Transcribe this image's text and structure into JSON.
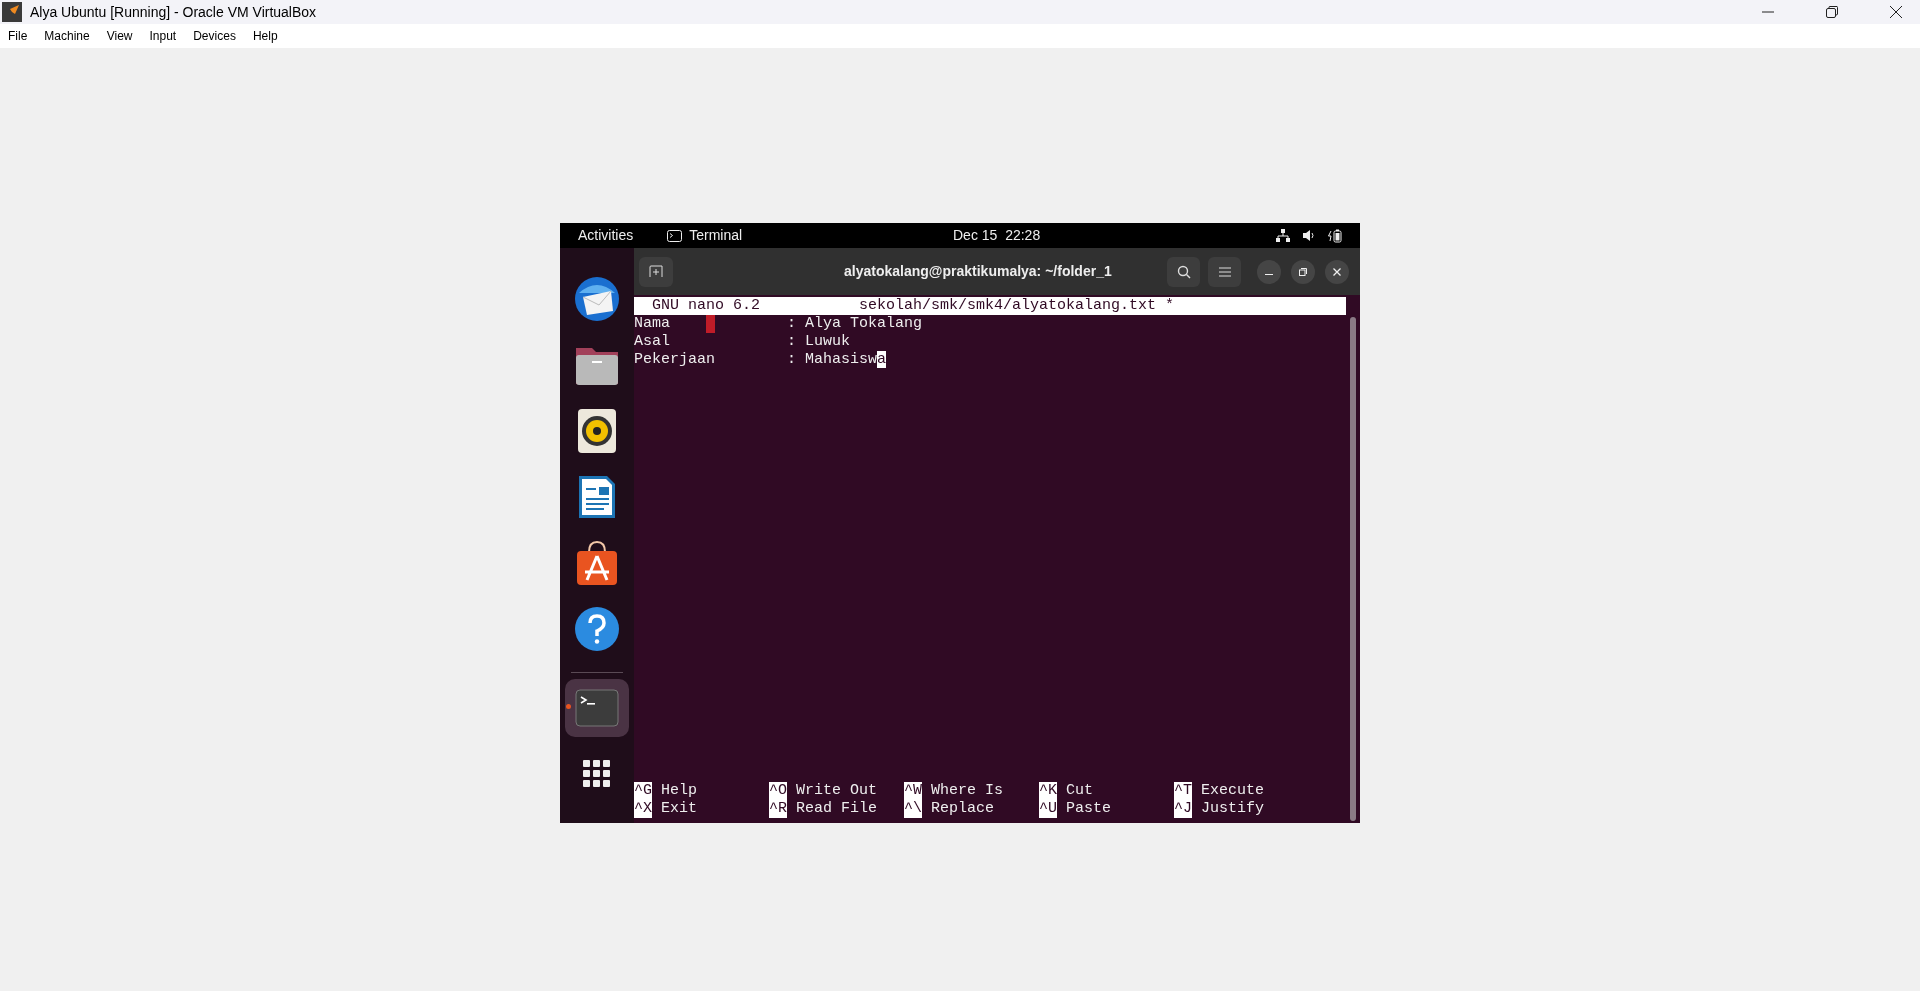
{
  "window": {
    "title": "Alya Ubuntu [Running] - Oracle VM VirtualBox"
  },
  "menu": [
    "File",
    "Machine",
    "View",
    "Input",
    "Devices",
    "Help"
  ],
  "vm": {
    "top_bar": {
      "activities": "Activities",
      "app": "Terminal",
      "clock": "Dec 15  22:28"
    },
    "dock": [
      {
        "kind": "mail",
        "running": false
      },
      {
        "kind": "files",
        "running": false
      },
      {
        "kind": "music",
        "running": false
      },
      {
        "kind": "writer",
        "running": false
      },
      {
        "kind": "software",
        "running": false
      },
      {
        "kind": "help",
        "running": false
      },
      {
        "kind": "terminal",
        "running": true
      },
      {
        "kind": "apps",
        "running": false
      }
    ],
    "terminal": {
      "title": "alyatokalang@praktikumalya: ~/folder_1",
      "nano": {
        "version": "GNU nano 6.2",
        "file": "sekolah/smk/smk4/alyatokalang.txt *",
        "lines": [
          {
            "label": "Nama",
            "value": ": Alya Tokalang",
            "whitespace_mark": true,
            "cursor": false
          },
          {
            "label": "Asal",
            "value": ": Luwuk",
            "whitespace_mark": false,
            "cursor": false
          },
          {
            "label": "Pekerjaan",
            "value": ": Mahasiswa",
            "whitespace_mark": false,
            "cursor": true
          }
        ],
        "shortcuts": [
          [
            {
              "key": "^G",
              "label": "Help"
            },
            {
              "key": "^O",
              "label": "Write Out"
            },
            {
              "key": "^W",
              "label": "Where Is"
            },
            {
              "key": "^K",
              "label": "Cut"
            },
            {
              "key": "^T",
              "label": "Execute"
            }
          ],
          [
            {
              "key": "^X",
              "label": "Exit"
            },
            {
              "key": "^R",
              "label": "Read File"
            },
            {
              "key": "^\\",
              "label": "Replace"
            },
            {
              "key": "^U",
              "label": "Paste"
            },
            {
              "key": "^J",
              "label": "Justify"
            }
          ]
        ]
      }
    }
  }
}
